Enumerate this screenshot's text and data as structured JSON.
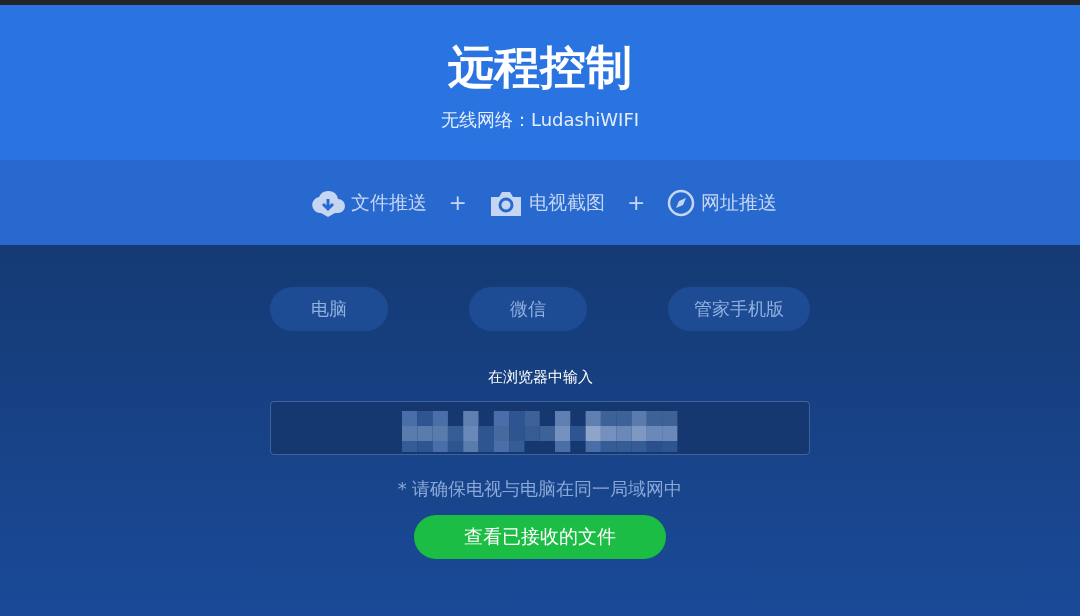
{
  "header": {
    "title": "远程控制",
    "network": "无线网络：LudashiWIFI"
  },
  "features": [
    {
      "kind": "cloud",
      "label": "文件推送"
    },
    {
      "kind": "camera",
      "label": "电视截图"
    },
    {
      "kind": "compass",
      "label": "网址推送"
    }
  ],
  "separator": "+",
  "tabs": [
    {
      "label": "电脑"
    },
    {
      "label": "微信"
    },
    {
      "label": "管家手机版"
    }
  ],
  "prompt": "在浏览器中输入",
  "note": "* 请确保电视与电脑在同一局域网中",
  "button": "查看已接收的文件"
}
